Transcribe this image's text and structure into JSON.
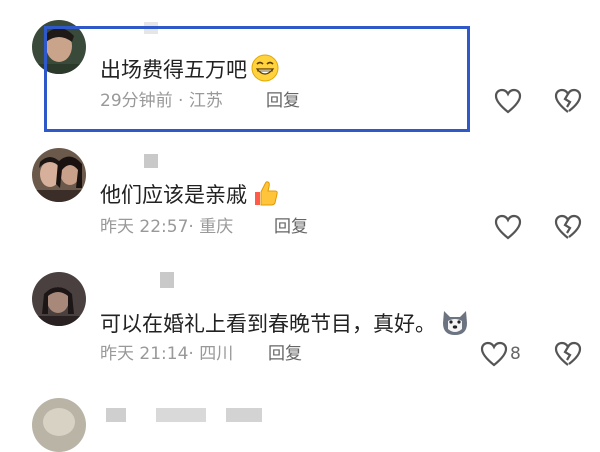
{
  "comments": [
    {
      "text": "出场费得五万吧",
      "time": "29分钟前",
      "sep": "·",
      "location": "江苏",
      "reply": "回复",
      "likes": ""
    },
    {
      "text": "他们应该是亲戚",
      "time": "昨天 22:57",
      "sep": "·",
      "location": "重庆",
      "reply": "回复",
      "likes": ""
    },
    {
      "text": "可以在婚礼上看到春晚节目，真好。",
      "time": "昨天 21:14",
      "sep": "·",
      "location": "四川",
      "reply": "回复",
      "likes": "8"
    }
  ],
  "icons": {
    "like": "heart-icon",
    "dislike": "broken-heart-icon"
  },
  "colors": {
    "highlight_border": "#2f59c9",
    "meta_text": "#999999"
  }
}
